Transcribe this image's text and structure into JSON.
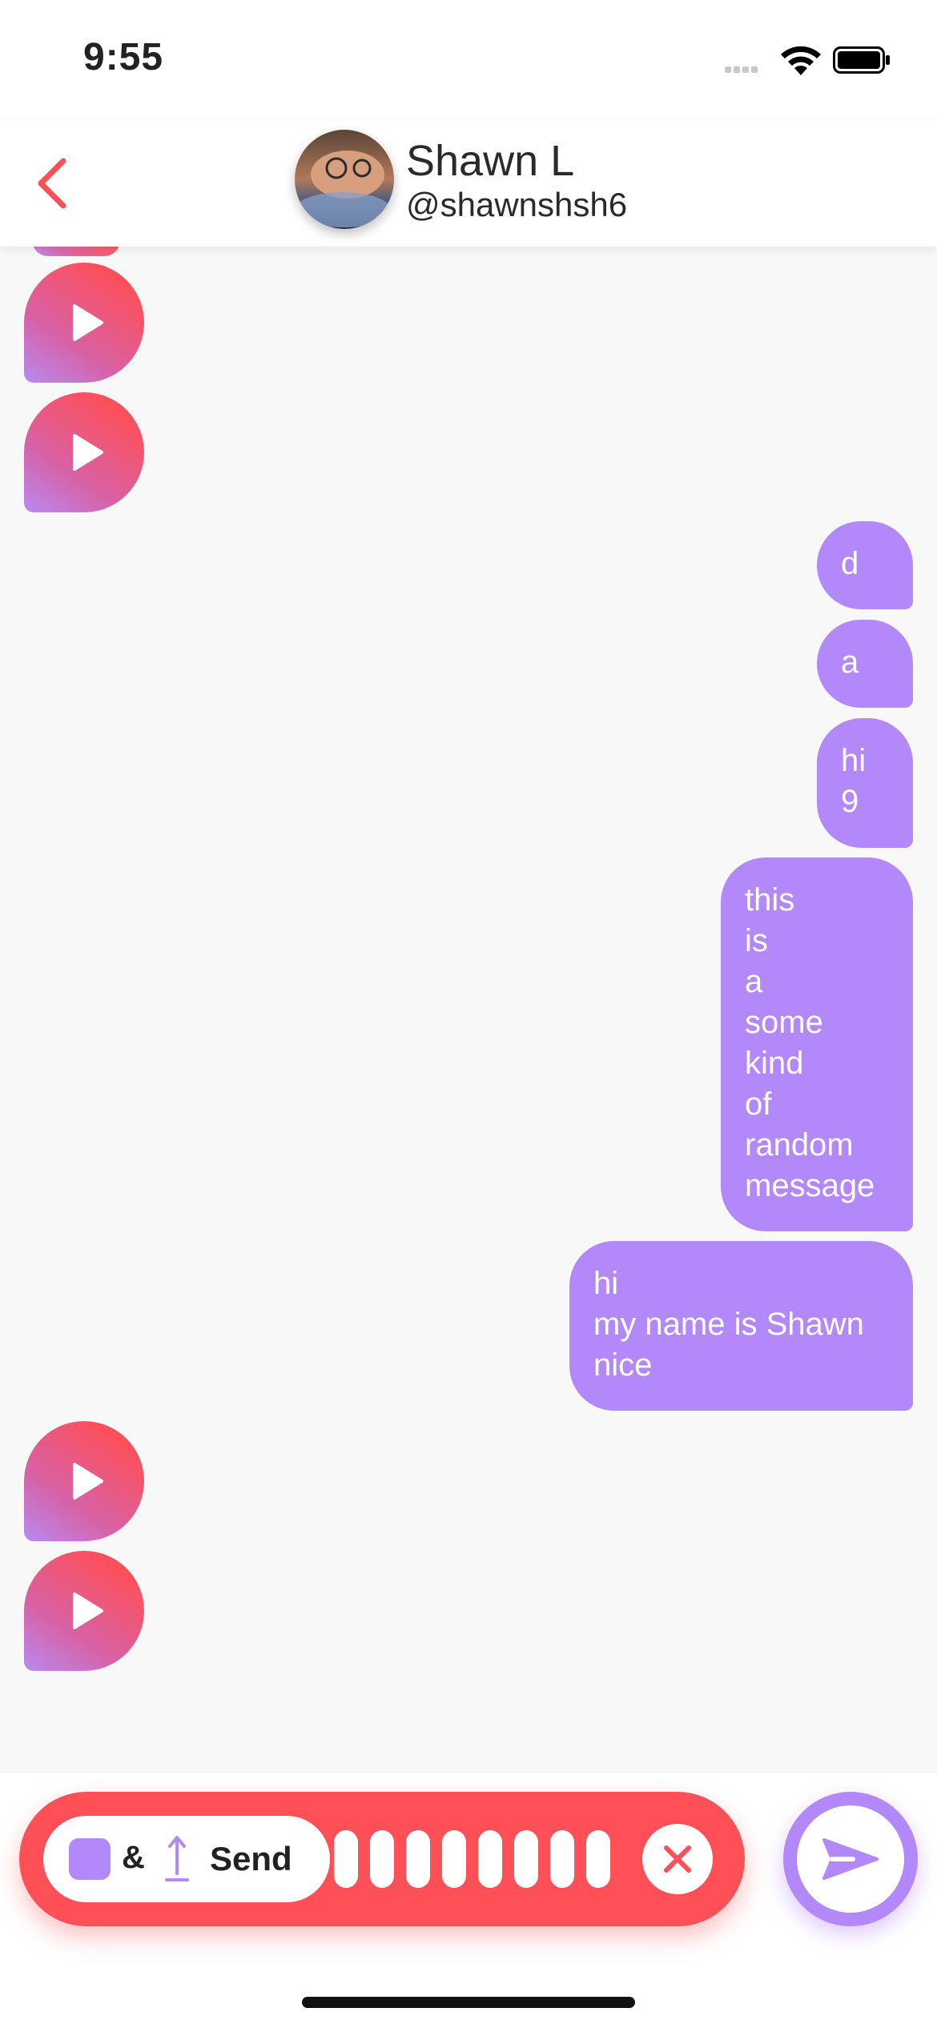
{
  "status_bar": {
    "time": "9:55",
    "icons": [
      "signal-icon",
      "wifi-icon",
      "battery-icon"
    ]
  },
  "header": {
    "back_icon": "chevron-left-icon",
    "contact_name": "Shawn L",
    "contact_handle": "@shawnshsh6"
  },
  "messages": [
    {
      "type": "voice",
      "direction": "incoming",
      "partial": true
    },
    {
      "type": "voice",
      "direction": "incoming"
    },
    {
      "type": "voice",
      "direction": "incoming"
    },
    {
      "type": "text",
      "direction": "outgoing",
      "lines": [
        "d"
      ]
    },
    {
      "type": "text",
      "direction": "outgoing",
      "lines": [
        "a"
      ]
    },
    {
      "type": "text",
      "direction": "outgoing",
      "lines": [
        "hi",
        "9"
      ]
    },
    {
      "type": "text",
      "direction": "outgoing",
      "lines": [
        "this",
        "is",
        "a",
        "some",
        "kind",
        "of",
        "random",
        "message"
      ]
    },
    {
      "type": "text",
      "direction": "outgoing",
      "lines": [
        "hi",
        "my name is Shawn",
        "nice"
      ]
    },
    {
      "type": "voice",
      "direction": "incoming"
    },
    {
      "type": "voice",
      "direction": "incoming"
    }
  ],
  "composer": {
    "ampersand": "&",
    "send_label": "Send",
    "waveform_bar_count": 8,
    "cancel_icon": "close-icon",
    "send_icon": "paper-plane-icon"
  },
  "colors": {
    "accent_purple": "#b388fb",
    "accent_red": "#ff4f57",
    "background": "#f8f8f9"
  }
}
